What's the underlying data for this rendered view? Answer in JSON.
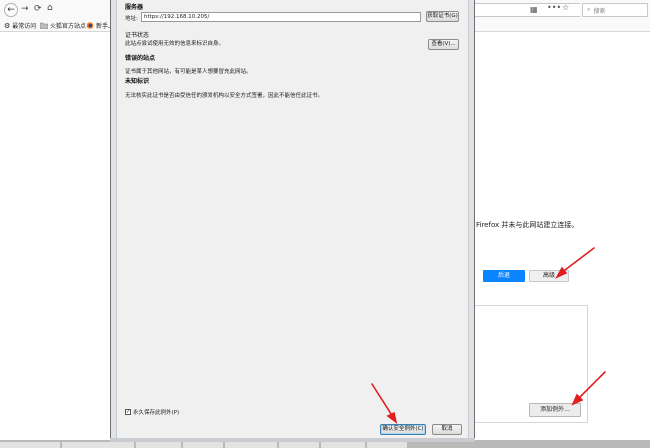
{
  "browser": {
    "back_glyph": "←",
    "forward_glyph": "→",
    "reload_glyph": "⟳",
    "home_glyph": "⌂",
    "search_placeholder": "搜索",
    "bookmarks": [
      {
        "label": "最常访问",
        "icon": "gear-icon"
      },
      {
        "label": "火狐官方站点",
        "icon": "folder-icon"
      },
      {
        "label": "新手上",
        "icon": "firefox-icon"
      }
    ]
  },
  "dialog": {
    "server_heading": "服务器",
    "address_label": "地址:",
    "address_value": "https://192.168.10.205/",
    "get_cert_button": "获取证书(G)",
    "cert_status_heading": "证书状态",
    "cert_status_text": "此站点尝试使用无效的信息来标识自身。",
    "view_button": "查看(V)...",
    "wrong_site_heading": "错误的站点",
    "wrong_site_text": "证书属于其他网站，有可能是某人想要冒充此网站。",
    "unknown_heading": "未知标识",
    "unknown_text": "无法核实此证书是否由受信任的颁发机构以安全方式签署，因此不能信任此证书。",
    "permanent_checkbox": "永久保存此例外(P)",
    "permanent_checked": true,
    "confirm_button": "确认安全例外(C)",
    "cancel_button": "取消"
  },
  "page": {
    "message": "Firefox 并未与此网站建立连接。",
    "back_button": "后退",
    "advanced_button": "高级",
    "add_exception_button": "添加例外..."
  },
  "colors": {
    "accent_blue": "#0a84ff",
    "annotation_red": "#e02020"
  }
}
